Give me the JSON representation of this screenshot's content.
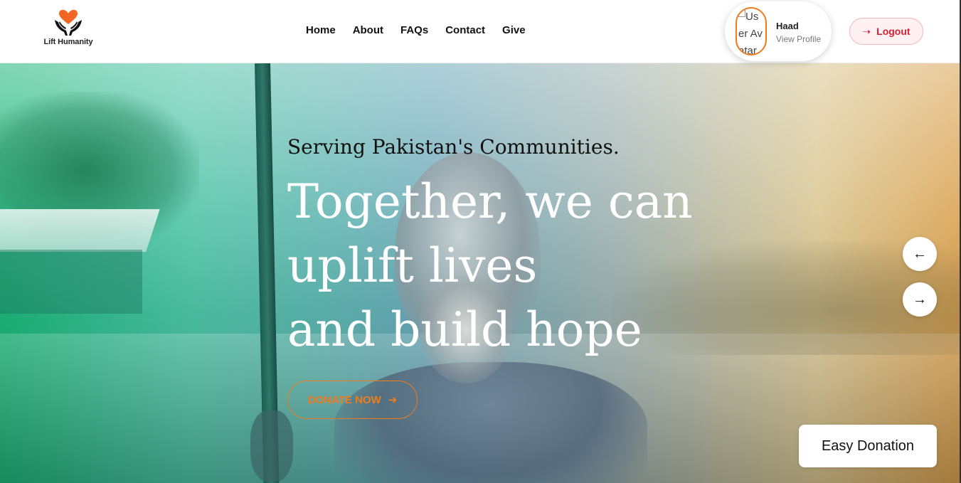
{
  "brand": {
    "name": "Lift Humanity",
    "logo_icon": "heart-hands-icon",
    "heart_color": "#f26522"
  },
  "nav": {
    "items": [
      {
        "label": "Home"
      },
      {
        "label": "About"
      },
      {
        "label": "FAQs"
      },
      {
        "label": "Contact"
      },
      {
        "label": "Give"
      }
    ]
  },
  "profile": {
    "avatar_alt": "User Avatar",
    "name": "Haad",
    "subtitle": "View Profile"
  },
  "logout": {
    "icon": "arrow-right-icon",
    "label": "Logout",
    "color": "#d61f33"
  },
  "hero": {
    "subtitle": "Serving Pakistan's Communities.",
    "title_lines": [
      "Together, we can",
      "uplift lives",
      "and build hope"
    ],
    "donate_label": "DONATE NOW",
    "donate_arrow": "➜",
    "prev_arrow": "←",
    "next_arrow": "→",
    "easy_donation_label": "Easy Donation",
    "accent_color": "#f07c1d"
  }
}
